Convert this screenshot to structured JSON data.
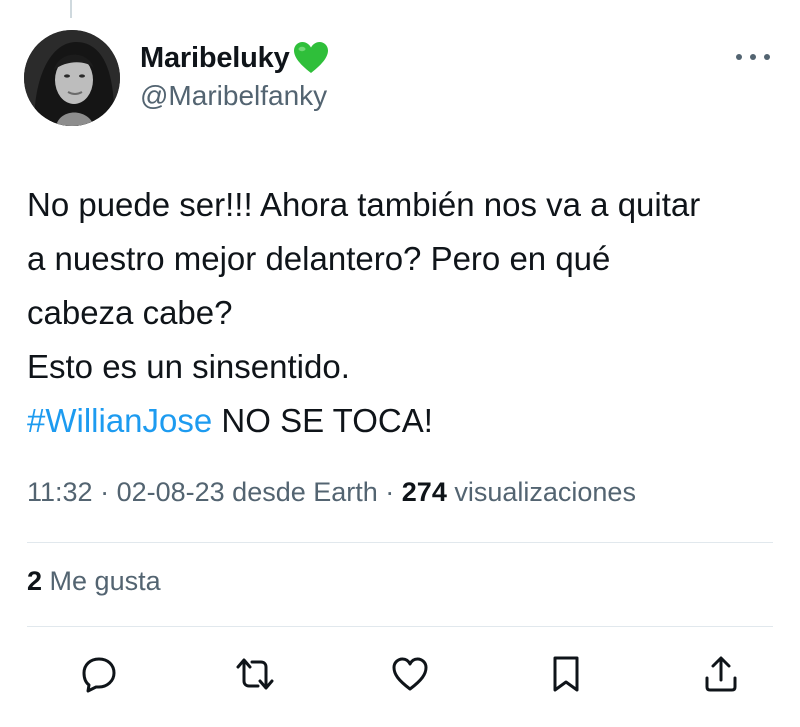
{
  "tweet": {
    "display_name": "Maribeluky",
    "handle": "@Maribelfanky",
    "text_lines": [
      "No puede ser!!! Ahora también nos va a quitar",
      "a nuestro mejor delantero? Pero en qué",
      "cabeza cabe?",
      "Esto es un sinsentido."
    ],
    "hashtag": "#WillianJose",
    "after_hashtag": " NO SE TOCA!",
    "time": "11:32",
    "date": "02-08-23",
    "source": "desde Earth",
    "separator": " · ",
    "views_count": "274",
    "views_label": "visualizaciones",
    "likes_count": "2",
    "likes_label": "Me gusta"
  },
  "icons": {
    "verified": "green-heart-icon",
    "more": "more-horizontal-icon",
    "reply": "reply-icon",
    "retweet": "retweet-icon",
    "like": "heart-icon",
    "bookmark": "bookmark-icon",
    "share": "share-icon"
  },
  "colors": {
    "text": "#0f1419",
    "secondary": "#536471",
    "hashtag": "#1d9bf0",
    "heart_badge": "#2fbf3a"
  }
}
